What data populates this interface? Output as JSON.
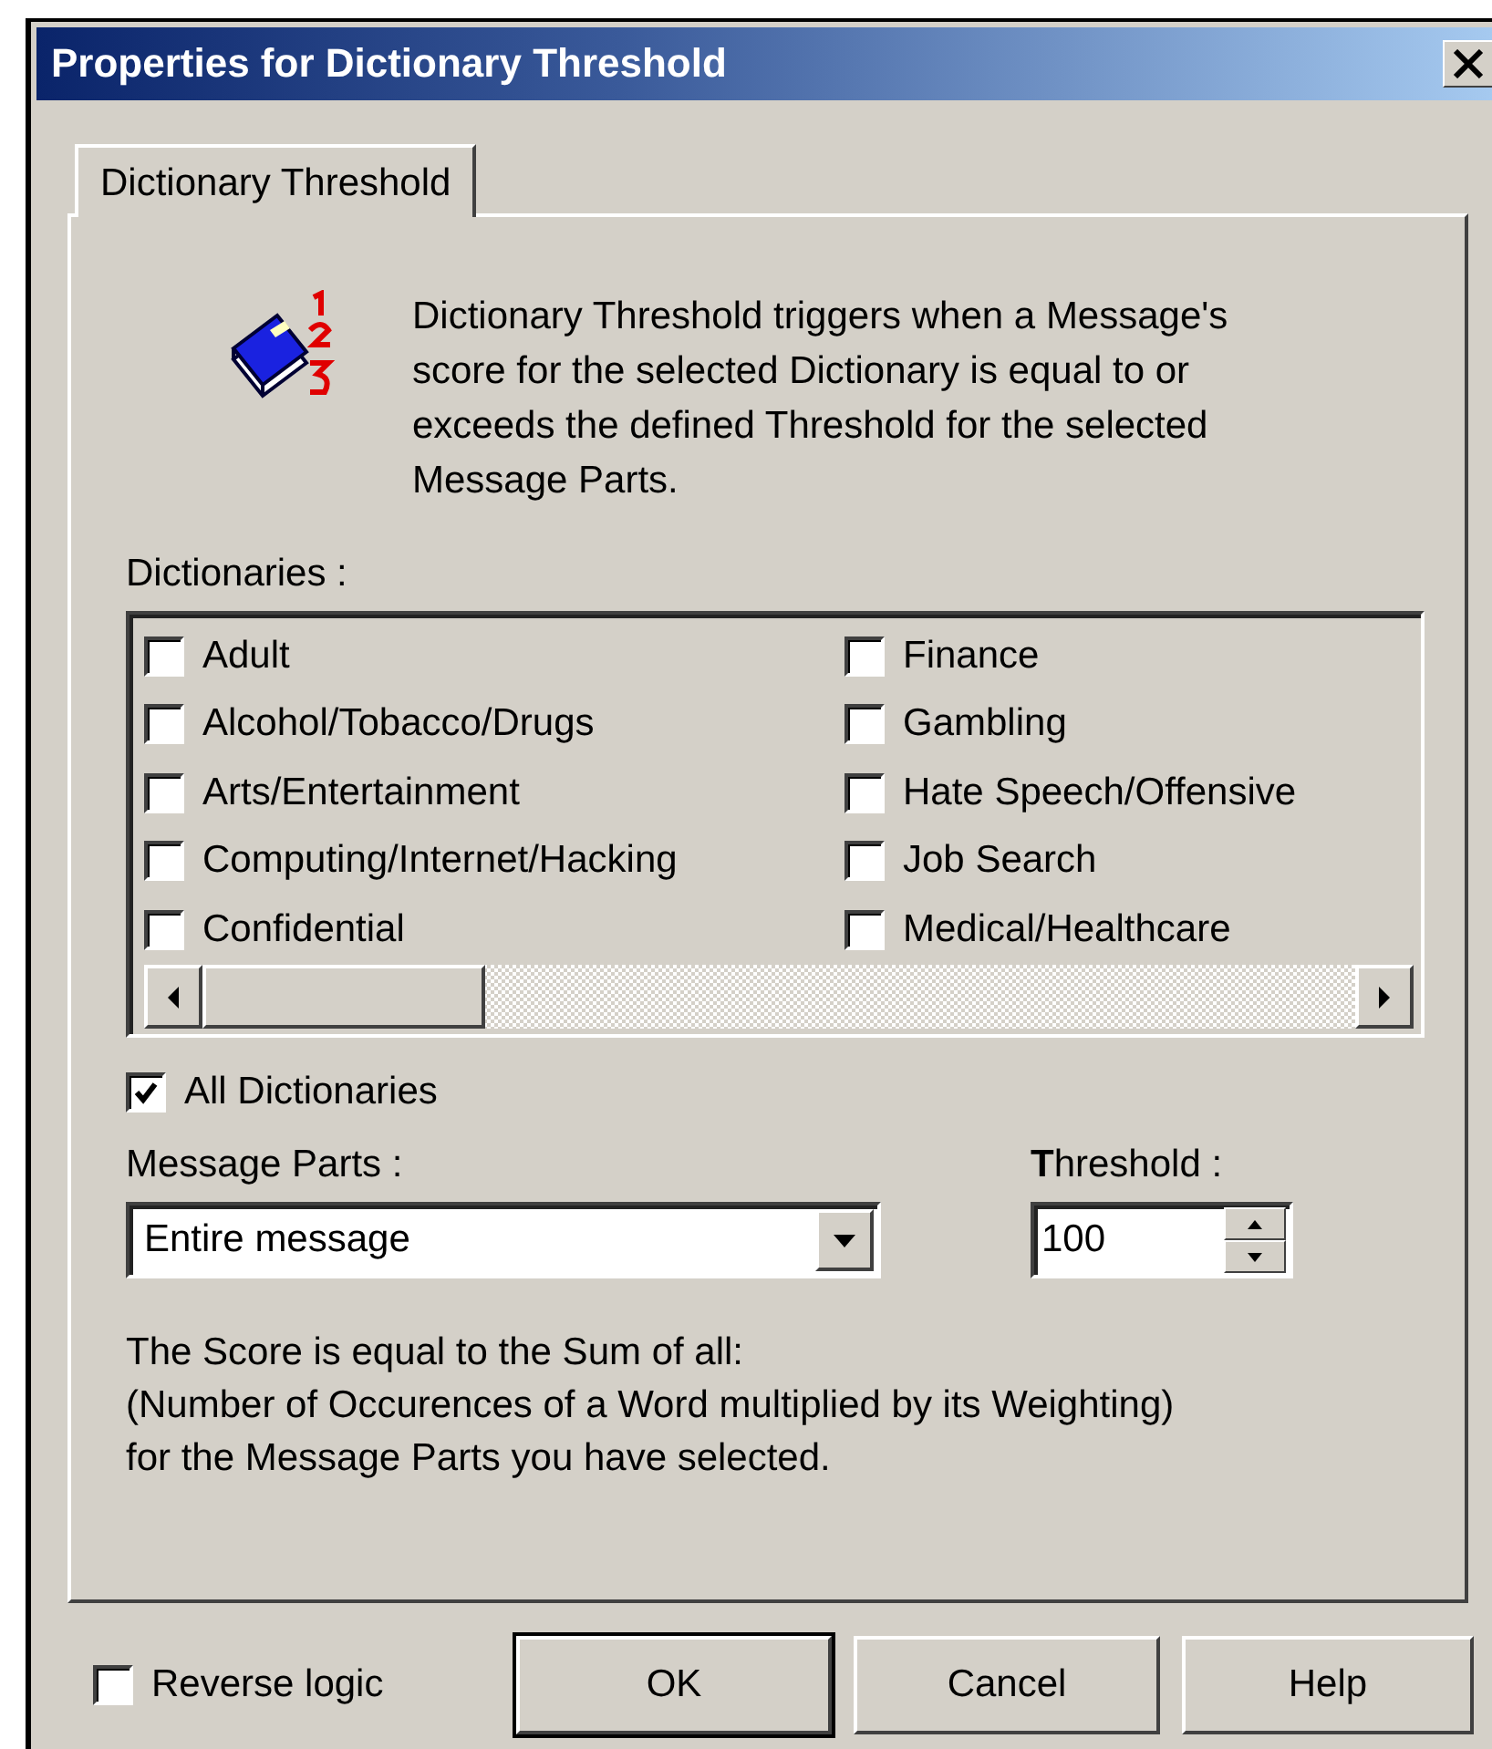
{
  "window": {
    "title": "Properties for Dictionary Threshold"
  },
  "tabs": [
    {
      "label": "Dictionary Threshold",
      "selected": true
    }
  ],
  "description": [
    "Dictionary Threshold triggers when a Message's",
    "score for the selected Dictionary is equal to or",
    "exceeds the defined Threshold for the selected",
    "Message Parts."
  ],
  "dictionaries_label": "Dictionaries :",
  "dictionaries": [
    {
      "label": "Adult",
      "checked": false
    },
    {
      "label": "Alcohol/Tobacco/Drugs",
      "checked": false
    },
    {
      "label": "Arts/Entertainment",
      "checked": false
    },
    {
      "label": "Computing/Internet/Hacking",
      "checked": false
    },
    {
      "label": "Confidential",
      "checked": false
    },
    {
      "label": "Finance",
      "checked": false
    },
    {
      "label": "Gambling",
      "checked": false
    },
    {
      "label": "Hate Speech/Offensive",
      "checked": false
    },
    {
      "label": "Job Search",
      "checked": false
    },
    {
      "label": "Medical/Healthcare",
      "checked": false
    }
  ],
  "all_dictionaries": {
    "label": "All Dictionaries",
    "checked": true
  },
  "message_parts": {
    "label": "Message Parts :",
    "value": "Entire message"
  },
  "threshold": {
    "label": "**T**hreshold :",
    "value": "100"
  },
  "score_note": [
    "The Score is equal to the Sum of all:",
    "(Number of Occurences of a Word multiplied by its Weighting)",
    "for the Message Parts you have selected."
  ],
  "reverse_logic": {
    "label": "Reverse logic",
    "checked": false
  },
  "buttons": [
    {
      "label": "OK",
      "default": true
    },
    {
      "label": "Cancel",
      "default": false
    },
    {
      "label": "Help",
      "default": false
    }
  ]
}
